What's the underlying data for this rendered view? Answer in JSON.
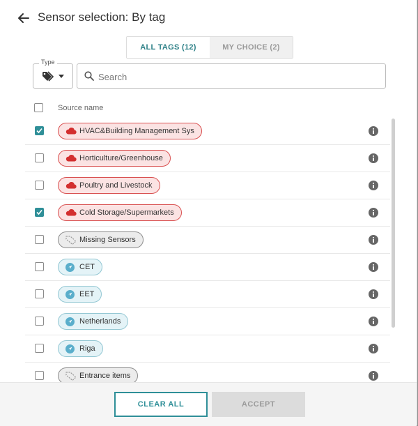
{
  "header": {
    "title": "Sensor selection: By tag",
    "back_icon": "arrow-left-icon"
  },
  "tabs": [
    {
      "label": "ALL TAGS (12)",
      "active": true
    },
    {
      "label": "MY CHOICE (2)",
      "active": false
    }
  ],
  "filter": {
    "type_label": "Type",
    "type_icon": "tags-icon"
  },
  "search": {
    "placeholder": "Search",
    "value": ""
  },
  "list": {
    "column_header": "Source name",
    "rows": [
      {
        "label": "HVAC&Building Management Sys",
        "icon": "cloud-icon",
        "checked": true
      },
      {
        "label": "Horticulture/Greenhouse",
        "icon": "cloud-icon",
        "checked": false
      },
      {
        "label": "Poultry and Livestock",
        "icon": "cloud-icon",
        "checked": false
      },
      {
        "label": "Cold Storage/Supermarkets",
        "icon": "cloud-icon",
        "checked": true
      },
      {
        "label": "Missing Sensors",
        "icon": "dashed-tag-icon",
        "checked": false
      },
      {
        "label": "CET",
        "icon": "location-icon",
        "checked": false
      },
      {
        "label": "EET",
        "icon": "location-icon",
        "checked": false
      },
      {
        "label": "Netherlands",
        "icon": "location-icon",
        "checked": false
      },
      {
        "label": "Riga",
        "icon": "location-icon",
        "checked": false
      },
      {
        "label": "Entrance items",
        "icon": "dashed-tag-icon",
        "checked": false
      }
    ]
  },
  "footer": {
    "clear_label": "CLEAR ALL",
    "accept_label": "ACCEPT"
  },
  "colors": {
    "accent": "#2f8f98",
    "cloud": "#d32f2f",
    "location": "#5aaecb",
    "muted": "#9b9b9b"
  }
}
